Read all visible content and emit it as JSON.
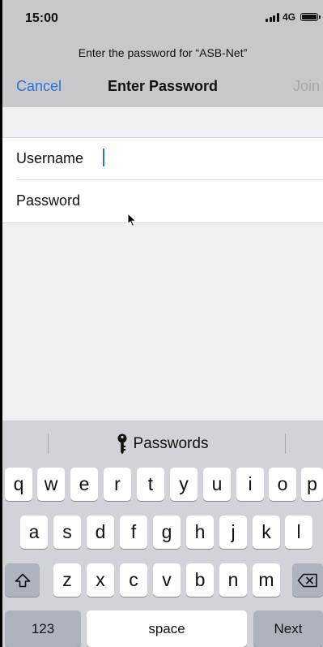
{
  "status_bar": {
    "time": "15:00",
    "network": "4G"
  },
  "header": {
    "prompt": "Enter the password for “ASB-Net”",
    "cancel_label": "Cancel",
    "title": "Enter Password",
    "join_label": "Join"
  },
  "form": {
    "username_label": "Username",
    "username_value": "",
    "password_label": "Password",
    "password_value": ""
  },
  "keyboard": {
    "suggestion": "Passwords",
    "row1": [
      "q",
      "w",
      "e",
      "r",
      "t",
      "y",
      "u",
      "i",
      "o",
      "p"
    ],
    "row2": [
      "a",
      "s",
      "d",
      "f",
      "g",
      "h",
      "j",
      "k",
      "l"
    ],
    "row3": [
      "z",
      "x",
      "c",
      "v",
      "b",
      "n",
      "m"
    ],
    "numbers_label": "123",
    "space_label": "space",
    "next_label": "Next"
  },
  "colors": {
    "accent": "#2a73d9",
    "disabled": "#a6a6ab",
    "header_bg": "#c8c8cc",
    "keyboard_bg": "#d1d3d9"
  }
}
